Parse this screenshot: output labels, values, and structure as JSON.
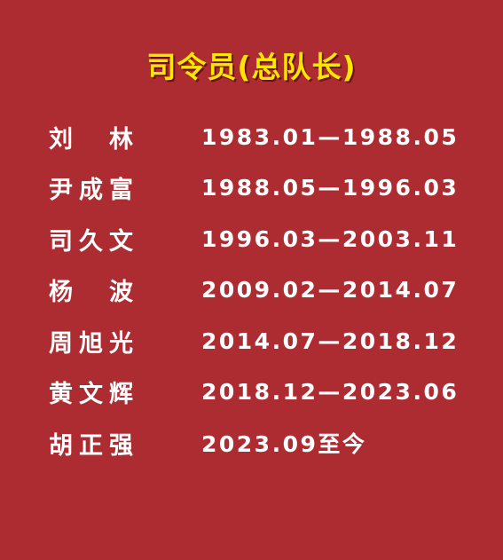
{
  "title": "司令员(总队长)",
  "entries": [
    {
      "name_chars": [
        "刘",
        "林"
      ],
      "term": "1983.01—1988.05"
    },
    {
      "name_chars": [
        "尹",
        "成",
        "富"
      ],
      "term": "1988.05—1996.03"
    },
    {
      "name_chars": [
        "司",
        "久",
        "文"
      ],
      "term": "1996.03—2003.11"
    },
    {
      "name_chars": [
        "杨",
        "波"
      ],
      "term": "2009.02—2014.07"
    },
    {
      "name_chars": [
        "周",
        "旭",
        "光"
      ],
      "term": "2014.07—2018.12"
    },
    {
      "name_chars": [
        "黄",
        "文",
        "辉"
      ],
      "term": "2018.12—2023.06"
    },
    {
      "name_chars": [
        "胡",
        "正",
        "强"
      ],
      "term": "2023.09至今"
    }
  ],
  "colors": {
    "background": "#ad2c32",
    "title": "#ffe600",
    "text": "#ffffff"
  }
}
